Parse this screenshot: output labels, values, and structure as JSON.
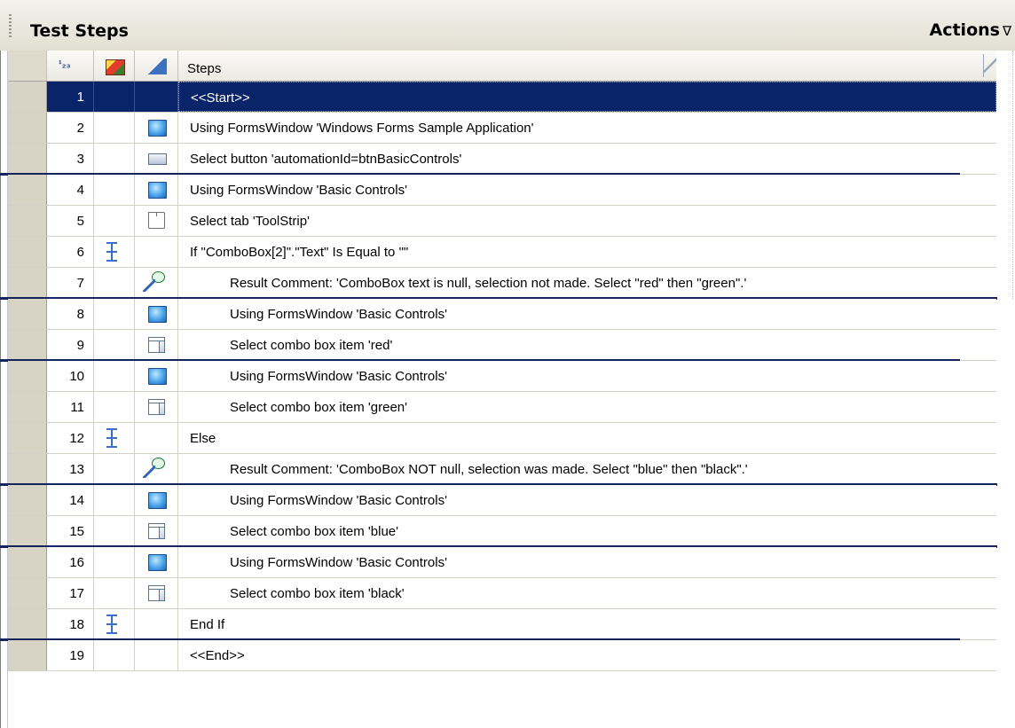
{
  "panel": {
    "title": "Test Steps",
    "actions_label": "Actions",
    "actions_arrow": "∇"
  },
  "columns": {
    "number_icon": "numbered-column-icon",
    "object_icon": "object-repository-icon",
    "type_icon": "step-type-icon",
    "steps_label": "Steps"
  },
  "rows": [
    {
      "num": "1",
      "icon": "",
      "flow": false,
      "indent": false,
      "text": "<<Start>>",
      "selected": true
    },
    {
      "num": "2",
      "icon": "window",
      "flow": false,
      "indent": false,
      "text": "Using FormsWindow 'Windows Forms Sample Application'"
    },
    {
      "num": "3",
      "icon": "button",
      "flow": false,
      "indent": false,
      "text": "Select button 'automationId=btnBasicControls'"
    },
    {
      "num": "4",
      "icon": "window",
      "flow": false,
      "indent": false,
      "text": "Using FormsWindow 'Basic Controls'"
    },
    {
      "num": "5",
      "icon": "tab",
      "flow": false,
      "indent": false,
      "text": "Select tab 'ToolStrip'"
    },
    {
      "num": "6",
      "icon": "",
      "flow": true,
      "indent": false,
      "text": "If \"ComboBox[2]\".\"Text\" Is Equal to \"\""
    },
    {
      "num": "7",
      "icon": "comment",
      "flow": false,
      "indent": true,
      "text": "Result Comment: 'ComboBox text is null, selection not made. Select \"red\" then \"green\".'"
    },
    {
      "num": "8",
      "icon": "window",
      "flow": false,
      "indent": true,
      "text": "Using FormsWindow 'Basic Controls'"
    },
    {
      "num": "9",
      "icon": "combo",
      "flow": false,
      "indent": true,
      "text": "Select combo box item 'red'"
    },
    {
      "num": "10",
      "icon": "window",
      "flow": false,
      "indent": true,
      "text": "Using FormsWindow 'Basic Controls'"
    },
    {
      "num": "11",
      "icon": "combo",
      "flow": false,
      "indent": true,
      "text": "Select combo box item 'green'"
    },
    {
      "num": "12",
      "icon": "",
      "flow": true,
      "indent": false,
      "text": "Else"
    },
    {
      "num": "13",
      "icon": "comment",
      "flow": false,
      "indent": true,
      "text": "Result Comment: 'ComboBox NOT null, selection was made. Select \"blue\" then \"black\".'"
    },
    {
      "num": "14",
      "icon": "window",
      "flow": false,
      "indent": true,
      "text": "Using FormsWindow 'Basic Controls'"
    },
    {
      "num": "15",
      "icon": "combo",
      "flow": false,
      "indent": true,
      "text": "Select combo box item 'blue'"
    },
    {
      "num": "16",
      "icon": "window",
      "flow": false,
      "indent": true,
      "text": "Using FormsWindow 'Basic Controls'"
    },
    {
      "num": "17",
      "icon": "combo",
      "flow": false,
      "indent": true,
      "text": "Select combo box item 'black'"
    },
    {
      "num": "18",
      "icon": "",
      "flow": true,
      "indent": false,
      "text": "End If"
    },
    {
      "num": "19",
      "icon": "",
      "flow": false,
      "indent": false,
      "text": "<<End>>"
    }
  ],
  "colors": {
    "selected_row": "#0a246a",
    "separator": "#16245c"
  }
}
